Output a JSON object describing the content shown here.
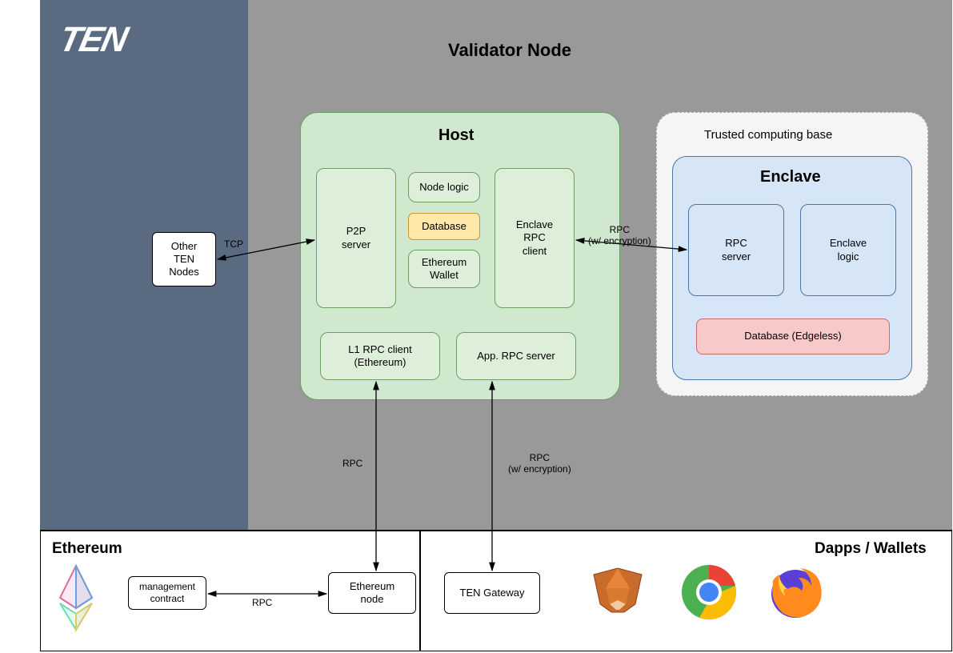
{
  "logo": "TEN",
  "validator_title": "Validator Node",
  "host_title": "Host",
  "tcb_title": "Trusted computing base",
  "enclave_title": "Enclave",
  "other_nodes": "Other\nTEN\nNodes",
  "p2p": "P2P\nserver",
  "node_logic": "Node logic",
  "database": "Database",
  "eth_wallet": "Ethereum\nWallet",
  "enclave_rpc_client": "Enclave\nRPC\nclient",
  "l1_rpc": "L1 RPC client\n(Ethereum)",
  "app_rpc": "App. RPC server",
  "rpc_server": "RPC\nserver",
  "enclave_logic": "Enclave\nlogic",
  "edgeless_db": "Database (Edgeless)",
  "ethereum_section": "Ethereum",
  "dapps_section": "Dapps / Wallets",
  "mgmt_contract": "management\ncontract",
  "eth_node": "Ethereum\nnode",
  "ten_gateway": "TEN Gateway",
  "lbl_tcp": "TCP",
  "lbl_rpc": "RPC",
  "lbl_rpc_enc": "RPC\n(w/ encryption)"
}
